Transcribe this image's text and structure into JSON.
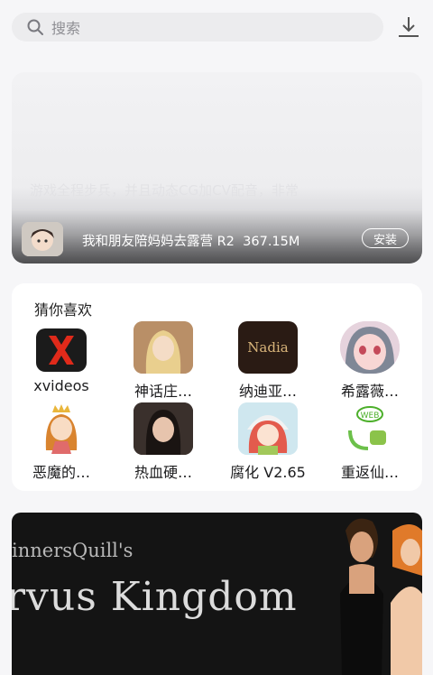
{
  "search": {
    "placeholder": "搜索",
    "icon": "search-icon"
  },
  "header": {
    "download_icon": "download-icon"
  },
  "banner": {
    "faded_text": "游戏全程步兵，并且动态CG加CV配音，非常",
    "app_title": "我和朋友陪妈妈去露营 R2",
    "size": "367.15M",
    "install_label": "安装"
  },
  "recommend": {
    "title": "猜你喜欢",
    "apps": [
      {
        "name": "xvideos"
      },
      {
        "name": "神话庄…"
      },
      {
        "name": "纳迪亚…",
        "icon_text": "Nadia"
      },
      {
        "name": "希露薇…"
      },
      {
        "name": "恶魔的…"
      },
      {
        "name": "热血硬…"
      },
      {
        "name": "腐化 V2.65"
      },
      {
        "name": "重返仙…",
        "icon_text": "WEB"
      }
    ]
  },
  "promo": {
    "subtitle": "innersQuill's",
    "title": "rvus Kingdom"
  },
  "colors": {
    "background": "#f6f6f8",
    "card": "#ffffff",
    "accent_red": "#e02a1a"
  }
}
